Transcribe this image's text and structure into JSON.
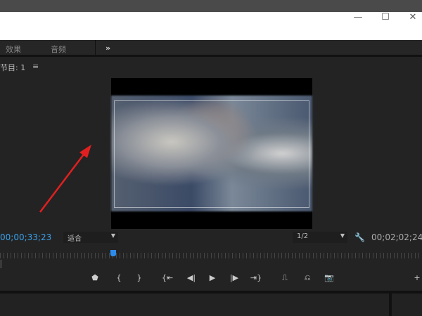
{
  "window": {
    "minimize": "—",
    "maximize": "☐",
    "close": "✕"
  },
  "tabs": [
    {
      "label": "效果"
    },
    {
      "label": "音频"
    },
    {
      "label": "»"
    }
  ],
  "panel": {
    "title": "节目: 1",
    "menu": "≡"
  },
  "timecode": {
    "current": "00;00;33;23",
    "duration": "00;02;02;24"
  },
  "zoom_select": {
    "value": "适合",
    "caret": "▼"
  },
  "resolution_select": {
    "value": "1/2",
    "caret": "▼"
  },
  "settings_icon": "🔧",
  "controls": [
    {
      "name": "add-marker",
      "glyph": "⬟"
    },
    {
      "name": "mark-in",
      "glyph": "{"
    },
    {
      "name": "mark-out",
      "glyph": "}"
    },
    {
      "name": "go-to-in",
      "glyph": "{⇤"
    },
    {
      "name": "step-back",
      "glyph": "◀|"
    },
    {
      "name": "play",
      "glyph": "▶"
    },
    {
      "name": "step-forward",
      "glyph": "|▶"
    },
    {
      "name": "go-to-out",
      "glyph": "⇥}"
    },
    {
      "name": "lift",
      "glyph": "⎍"
    },
    {
      "name": "extract",
      "glyph": "⎌"
    },
    {
      "name": "export-frame",
      "glyph": "📷"
    },
    {
      "name": "add-button",
      "glyph": "+"
    }
  ],
  "playhead_fraction": 0.27,
  "annotation_color": "#e02020"
}
